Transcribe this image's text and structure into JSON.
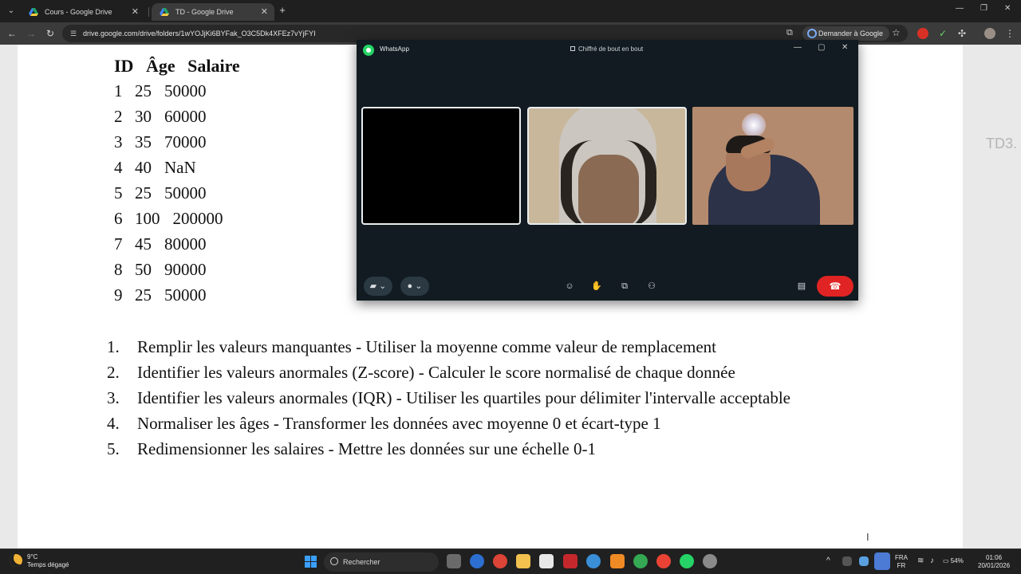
{
  "browser": {
    "tabs": [
      {
        "title": "Cours - Google Drive",
        "active": false
      },
      {
        "title": "TD - Google Drive",
        "active": true
      }
    ],
    "url": "drive.google.com/drive/folders/1wYOJjKi6BYFak_O3C5Dk4XFEz7vYjFYI",
    "ask_google": "Demander à Google"
  },
  "document": {
    "table_headers": [
      "ID",
      "Âge",
      "Salaire"
    ],
    "rows": [
      [
        "1",
        "25",
        "50000"
      ],
      [
        "2",
        "30",
        "60000"
      ],
      [
        "3",
        "35",
        "70000"
      ],
      [
        "4",
        "40",
        "NaN"
      ],
      [
        "5",
        "25",
        "50000"
      ],
      [
        "6",
        "100",
        "200000"
      ],
      [
        "7",
        "45",
        "80000"
      ],
      [
        "8",
        "50",
        "90000"
      ],
      [
        "9",
        "25",
        "50000"
      ]
    ],
    "tasks": [
      {
        "num": "1.",
        "text": "Remplir les valeurs manquantes - Utiliser la moyenne comme valeur de remplacement"
      },
      {
        "num": "2.",
        "text": "Identifier les valeurs anormales (Z-score) - Calculer le score normalisé de chaque donnée"
      },
      {
        "num": "3.",
        "text": "Identifier les valeurs anormales (IQR) - Utiliser les quartiles pour délimiter l'intervalle acceptable"
      },
      {
        "num": "4.",
        "text": "Normaliser les âges - Transformer les données avec moyenne 0 et écart-type 1"
      },
      {
        "num": "5.",
        "text": "Redimensionner les salaires - Mettre les données sur une échelle 0-1"
      }
    ],
    "side_text": "TD3."
  },
  "whatsapp": {
    "title": "WhatsApp",
    "encryption": "Chiffré de bout en bout",
    "colors": {
      "bg": "#111b21",
      "end_call": "#e02424",
      "logo": "#25d366"
    }
  },
  "taskbar": {
    "weather_temp": "9°C",
    "weather_desc": "Temps dégagé",
    "search_placeholder": "Rechercher",
    "lang_1": "FRA",
    "lang_2": "FR",
    "battery": "54%",
    "time": "01:06",
    "date": "20/01/2026"
  }
}
